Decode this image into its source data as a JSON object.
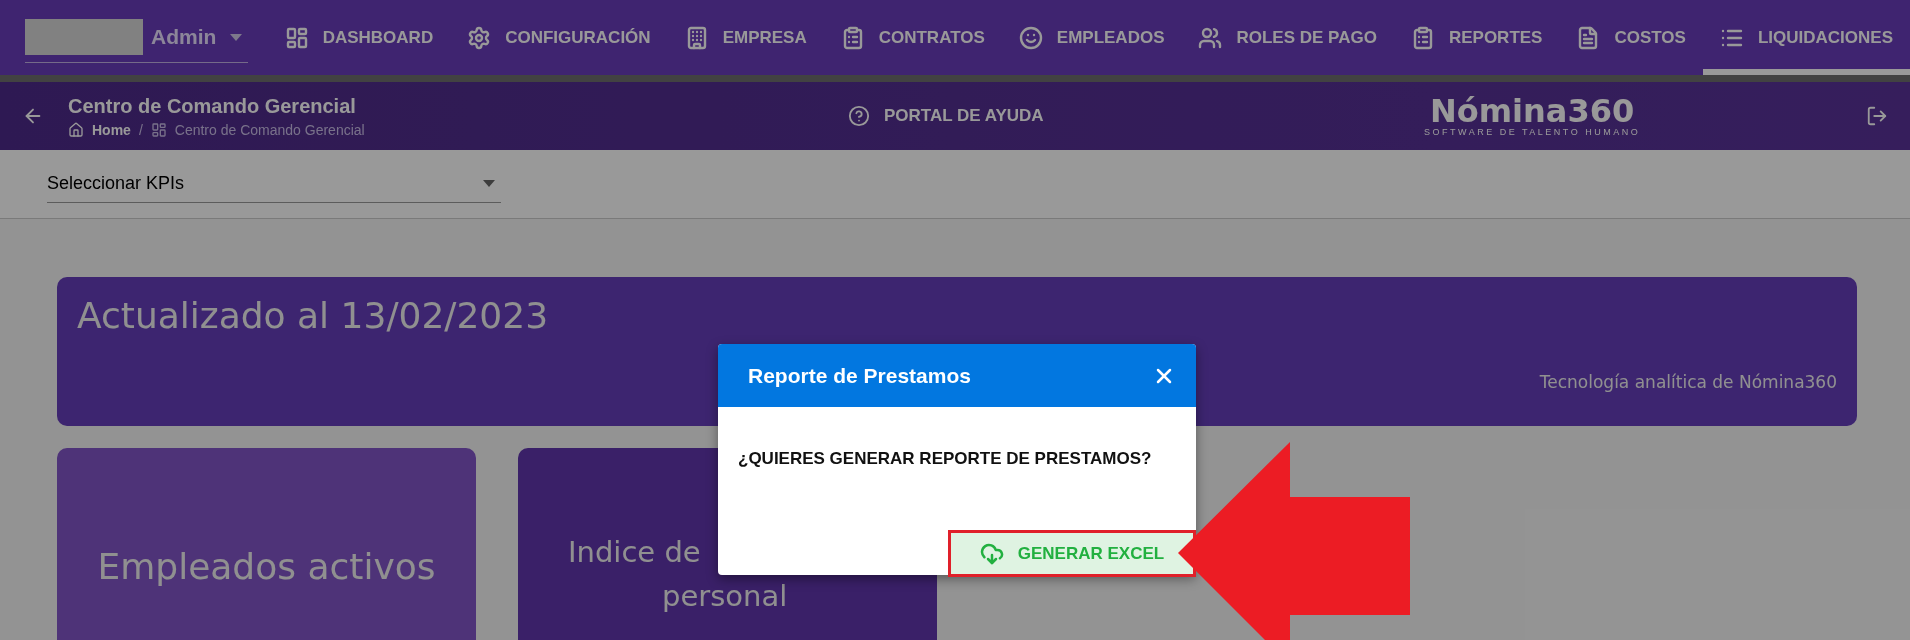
{
  "user_menu": {
    "label": "Admin"
  },
  "nav": [
    {
      "label": "DASHBOARD",
      "selected": false
    },
    {
      "label": "CONFIGURACIÓN",
      "selected": false
    },
    {
      "label": "EMPRESA",
      "selected": false
    },
    {
      "label": "CONTRATOS",
      "selected": false
    },
    {
      "label": "EMPLEADOS",
      "selected": false
    },
    {
      "label": "ROLES DE PAGO",
      "selected": false
    },
    {
      "label": "REPORTES",
      "selected": false
    },
    {
      "label": "COSTOS",
      "selected": false
    },
    {
      "label": "LIQUIDACIONES",
      "selected": true
    }
  ],
  "header": {
    "title": "Centro de Comando Gerencial",
    "breadcrumb": [
      "Home",
      "Centro de Comando Gerencial"
    ],
    "breadcrumb_separator": "/",
    "help_link": "PORTAL DE AYUDA",
    "logo": {
      "name": "Nómina360",
      "tagline": "SOFTWARE DE TALENTO HUMANO"
    }
  },
  "kpi_select": {
    "value": "Seleccionar KPIs"
  },
  "banner": {
    "title": "Actualizado al 13/02/2023",
    "caption": "Tecnología analítica de Nómina360"
  },
  "cards": [
    {
      "lines": [
        "Empleados activos"
      ]
    },
    {
      "lines": [
        "Indice de",
        "personal"
      ]
    }
  ],
  "dialog": {
    "title": "Reporte de Prestamos",
    "message": "¿QUIERES GENERAR REPORTE DE PRESTAMOS?",
    "action": "GENERAR EXCEL"
  }
}
